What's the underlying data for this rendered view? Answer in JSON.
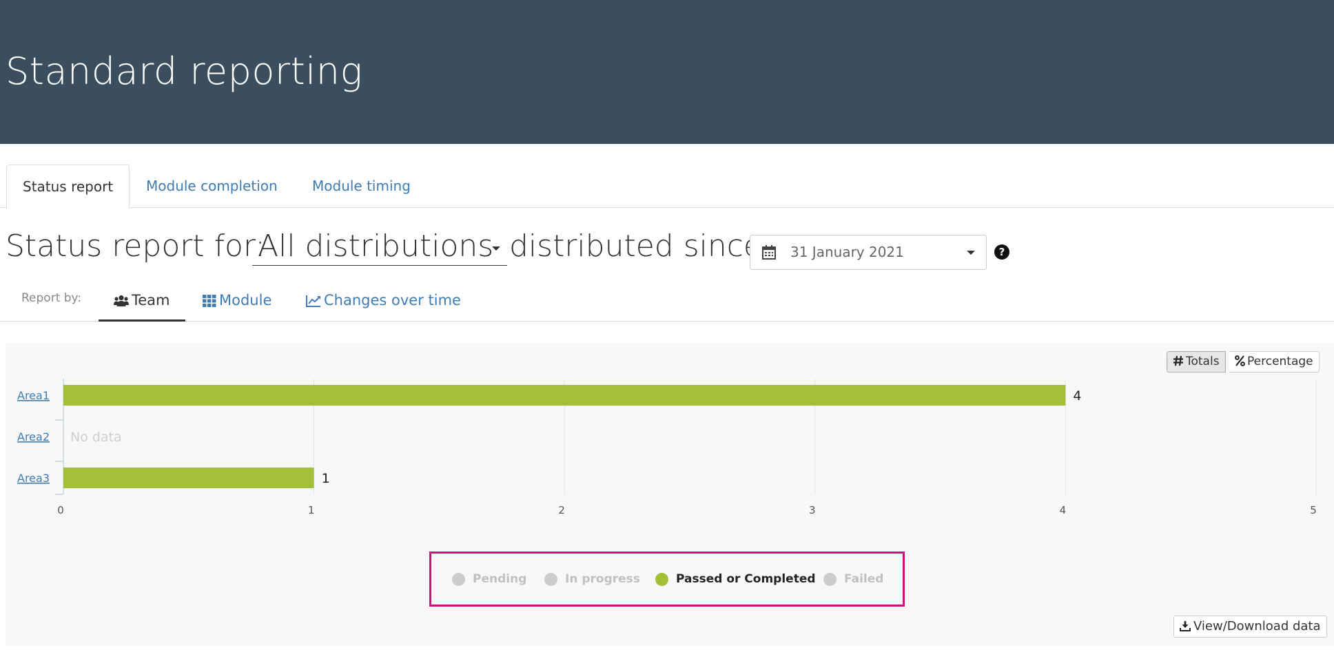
{
  "banner": {
    "title": "Standard reporting"
  },
  "tabs": [
    {
      "label": "Status report",
      "active": true
    },
    {
      "label": "Module completion",
      "active": false
    },
    {
      "label": "Module timing",
      "active": false
    }
  ],
  "heading": {
    "prefix": "Status report for:",
    "distribution": "All distributions",
    "middle": "distributed since",
    "date": "31 January 2021"
  },
  "report_by": {
    "label": "Report by:",
    "tabs": [
      {
        "label": "Team",
        "icon": "users-icon",
        "active": true
      },
      {
        "label": "Module",
        "icon": "grid-icon",
        "active": false
      },
      {
        "label": "Changes over time",
        "icon": "line-chart-icon",
        "active": false
      }
    ]
  },
  "view_toggle": {
    "totals": "Totals",
    "percentage": "Percentage",
    "selected": "Totals"
  },
  "chart_data": {
    "type": "bar",
    "orientation": "horizontal",
    "stacked": true,
    "categories": [
      "Area1",
      "Area2",
      "Area3"
    ],
    "series": [
      {
        "name": "Pending",
        "values": [
          0,
          0,
          0
        ],
        "visible": false,
        "color": "#cccccc"
      },
      {
        "name": "In progress",
        "values": [
          0,
          0,
          0
        ],
        "visible": false,
        "color": "#cccccc"
      },
      {
        "name": "Passed or Completed",
        "values": [
          4,
          null,
          1
        ],
        "visible": true,
        "color": "#a3bf3a"
      },
      {
        "name": "Failed",
        "values": [
          0,
          0,
          0
        ],
        "visible": false,
        "color": "#cccccc"
      }
    ],
    "data_labels": [
      "4",
      "",
      "1"
    ],
    "no_data_label": "No data",
    "xlim": [
      0,
      5
    ],
    "xticks": [
      "0",
      "1",
      "2",
      "3",
      "4",
      "5"
    ],
    "grid": true,
    "legend_position": "bottom-center"
  },
  "download": {
    "label": "View/Download data"
  }
}
